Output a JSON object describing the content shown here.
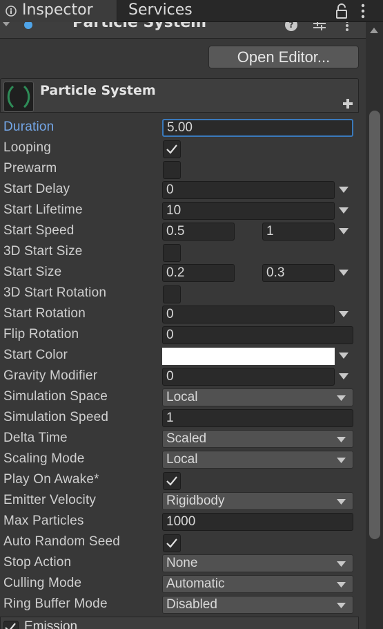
{
  "tabs": {
    "inspector": "Inspector",
    "services": "Services"
  },
  "component": {
    "title": "Particle System"
  },
  "toolbar": {
    "open_editor": "Open Editor..."
  },
  "module": {
    "title": "Particle System"
  },
  "properties": {
    "duration": {
      "label": "Duration",
      "value": "5.00"
    },
    "looping": {
      "label": "Looping",
      "checked": true
    },
    "prewarm": {
      "label": "Prewarm",
      "checked": false
    },
    "start_delay": {
      "label": "Start Delay",
      "value": "0"
    },
    "start_lifetime": {
      "label": "Start Lifetime",
      "value": "10"
    },
    "start_speed": {
      "label": "Start Speed",
      "min": "0.5",
      "max": "1"
    },
    "start_size_3d": {
      "label": "3D Start Size",
      "checked": false
    },
    "start_size": {
      "label": "Start Size",
      "min": "0.2",
      "max": "0.3"
    },
    "start_rotation_3d": {
      "label": "3D Start Rotation",
      "checked": false
    },
    "start_rotation": {
      "label": "Start Rotation",
      "value": "0"
    },
    "flip_rotation": {
      "label": "Flip Rotation",
      "value": "0"
    },
    "start_color": {
      "label": "Start Color",
      "color": "#ffffff"
    },
    "gravity_modifier": {
      "label": "Gravity Modifier",
      "value": "0"
    },
    "simulation_space": {
      "label": "Simulation Space",
      "value": "Local"
    },
    "simulation_speed": {
      "label": "Simulation Speed",
      "value": "1"
    },
    "delta_time": {
      "label": "Delta Time",
      "value": "Scaled"
    },
    "scaling_mode": {
      "label": "Scaling Mode",
      "value": "Local"
    },
    "play_on_awake": {
      "label": "Play On Awake*",
      "checked": true
    },
    "emitter_velocity": {
      "label": "Emitter Velocity",
      "value": "Rigidbody"
    },
    "max_particles": {
      "label": "Max Particles",
      "value": "1000"
    },
    "auto_random_seed": {
      "label": "Auto Random Seed",
      "checked": true
    },
    "stop_action": {
      "label": "Stop Action",
      "value": "None"
    },
    "culling_mode": {
      "label": "Culling Mode",
      "value": "Automatic"
    },
    "ring_buffer_mode": {
      "label": "Ring Buffer Mode",
      "value": "Disabled"
    }
  },
  "emission": {
    "label": "Emission",
    "checked": true
  },
  "colors": {
    "accent": "#74a7e8",
    "focus_border": "#3a79bb",
    "background": "#383838"
  }
}
